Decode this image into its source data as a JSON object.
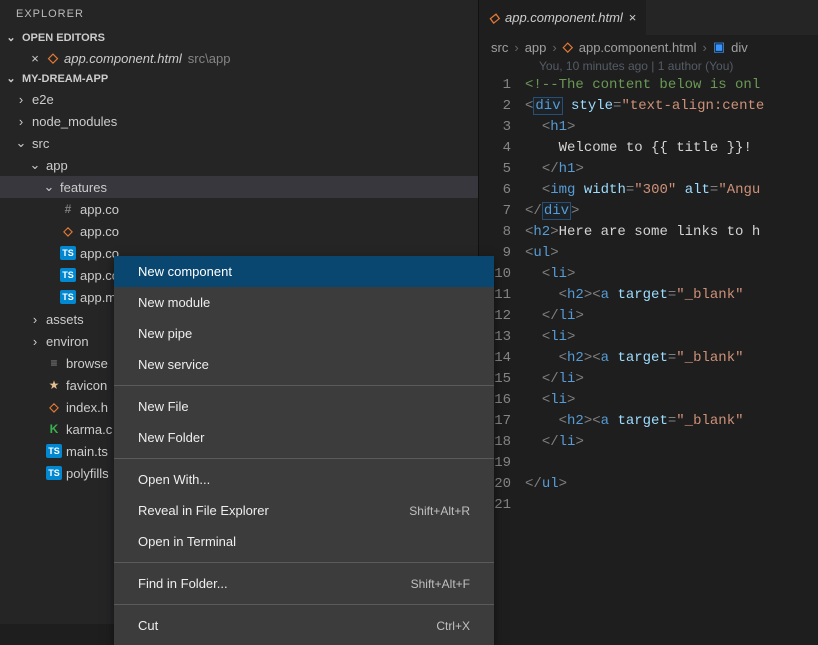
{
  "explorer": {
    "title": "EXPLORER"
  },
  "open_editors": {
    "title": "OPEN EDITORS",
    "items": [
      {
        "name": "app.component.html",
        "path": "src\\app"
      }
    ]
  },
  "project": {
    "name": "MY-DREAM-APP",
    "tree": [
      {
        "type": "folder",
        "label": "e2e",
        "expanded": false,
        "depth": 0
      },
      {
        "type": "folder",
        "label": "node_modules",
        "expanded": false,
        "depth": 0
      },
      {
        "type": "folder",
        "label": "src",
        "expanded": true,
        "depth": 0
      },
      {
        "type": "folder",
        "label": "app",
        "expanded": true,
        "depth": 1
      },
      {
        "type": "folder",
        "label": "features",
        "expanded": true,
        "depth": 2,
        "selected": true
      },
      {
        "type": "file",
        "label": "app.co",
        "icon": "hash",
        "depth": 2
      },
      {
        "type": "file",
        "label": "app.co",
        "icon": "html5",
        "depth": 2
      },
      {
        "type": "file",
        "label": "app.co",
        "icon": "ts",
        "depth": 2
      },
      {
        "type": "file",
        "label": "app.co",
        "icon": "ts",
        "depth": 2
      },
      {
        "type": "file",
        "label": "app.m",
        "icon": "ts",
        "depth": 2
      },
      {
        "type": "folder",
        "label": "assets",
        "expanded": false,
        "depth": 1
      },
      {
        "type": "folder",
        "label": "environ",
        "expanded": false,
        "depth": 1
      },
      {
        "type": "file",
        "label": "browse",
        "icon": "list",
        "depth": 1
      },
      {
        "type": "file",
        "label": "favicon",
        "icon": "star",
        "depth": 1
      },
      {
        "type": "file",
        "label": "index.h",
        "icon": "html5",
        "depth": 1
      },
      {
        "type": "file",
        "label": "karma.c",
        "icon": "karma",
        "depth": 1
      },
      {
        "type": "file",
        "label": "main.ts",
        "icon": "ts",
        "depth": 1
      },
      {
        "type": "file",
        "label": "polyfills",
        "icon": "ts",
        "depth": 1
      }
    ]
  },
  "context_menu": {
    "items": [
      {
        "label": "New component",
        "hi": true
      },
      {
        "label": "New module"
      },
      {
        "label": "New pipe"
      },
      {
        "label": "New service"
      },
      {
        "sep": true
      },
      {
        "label": "New File"
      },
      {
        "label": "New Folder"
      },
      {
        "sep": true
      },
      {
        "label": "Open With..."
      },
      {
        "label": "Reveal in File Explorer",
        "kbd": "Shift+Alt+R"
      },
      {
        "label": "Open in Terminal"
      },
      {
        "sep": true
      },
      {
        "label": "Find in Folder...",
        "kbd": "Shift+Alt+F"
      },
      {
        "sep": true
      },
      {
        "label": "Cut",
        "kbd": "Ctrl+X"
      }
    ]
  },
  "editor": {
    "tab": {
      "name": "app.component.html"
    },
    "breadcrumb": [
      "src",
      "app",
      "app.component.html",
      "div"
    ],
    "blame": "You, 10 minutes ago | 1 author (You)",
    "lines": [
      1,
      2,
      3,
      4,
      5,
      6,
      7,
      8,
      9,
      10,
      11,
      12,
      13,
      14,
      15,
      16,
      17,
      18,
      19,
      20,
      21
    ]
  },
  "code": {
    "l1": "<!--The content below is onl",
    "l2_tag": "div",
    "l2_attr": "style",
    "l2_val": "\"text-align:cente",
    "l3_tag": "h1",
    "l4": "Welcome to {{ title }}!",
    "l5_tag": "h1",
    "l6_tag": "img",
    "l6_a1": "width",
    "l6_v1": "\"300\"",
    "l6_a2": "alt",
    "l6_v2": "\"Angu",
    "l7_tag": "div",
    "l8_tag": "h2",
    "l8_text": "Here are some links to h",
    "l9_tag": "ul",
    "l10_tag": "li",
    "l11_h2": "h2",
    "l11_a": "a",
    "l11_attr": "target",
    "l11_val": "\"_blank\"",
    "l12_tag": "li",
    "l13_tag": "li",
    "l14_h2": "h2",
    "l14_a": "a",
    "l14_attr": "target",
    "l14_val": "\"_blank\"",
    "l15_tag": "li",
    "l16_tag": "li",
    "l17_h2": "h2",
    "l17_a": "a",
    "l17_attr": "target",
    "l17_val": "\"_blank\"",
    "l18_tag": "li",
    "l19_tag": "",
    "l20_tag": "ul"
  },
  "chart_data": null
}
